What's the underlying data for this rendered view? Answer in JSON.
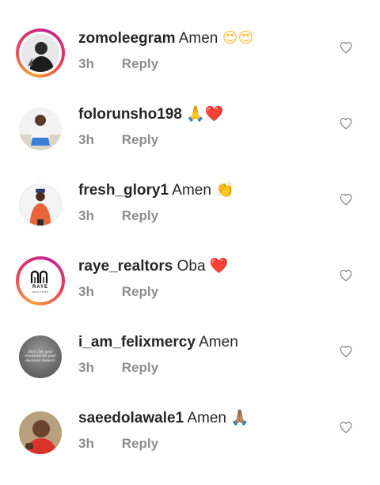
{
  "comments": [
    {
      "username": "zomoleegram",
      "text": "Amen",
      "emoji": "😍😍",
      "time": "3h",
      "reply": "Reply",
      "story_ring": true,
      "emoji_color": "#f6c343"
    },
    {
      "username": "folorunsho198",
      "text": "",
      "emoji": "🙏❤️",
      "time": "3h",
      "reply": "Reply",
      "story_ring": false,
      "emoji_color": "#e0302f"
    },
    {
      "username": "fresh_glory1",
      "text": "Amen",
      "emoji": "👏",
      "time": "3h",
      "reply": "Reply",
      "story_ring": false,
      "emoji_color": "#f6c343"
    },
    {
      "username": "raye_realtors",
      "text": "Oba",
      "emoji": "❤️",
      "time": "3h",
      "reply": "Reply",
      "story_ring": true,
      "emoji_color": "#e0302f"
    },
    {
      "username": "i_am_felixmercy",
      "text": "Amen",
      "emoji": "",
      "time": "3h",
      "reply": "Reply",
      "story_ring": false,
      "emoji_color": "#262626"
    },
    {
      "username": "saeedolawale1",
      "text": "Amen",
      "emoji": "🙏🏽",
      "time": "3h",
      "reply": "Reply",
      "story_ring": false,
      "emoji_color": "#c99a72"
    }
  ],
  "avatars": {
    "raye_logo_word": "RAYE",
    "raye_logo_sub": "REALTORS",
    "felix_avatar_text": "Don't let your emotions be your decision makers"
  },
  "colors": {
    "username": "#262626",
    "meta": "#8e8e8e",
    "heart_outline": "#8e8e8e",
    "story_ring_start": "#f9a23a",
    "story_ring_end": "#c1278f"
  },
  "icons": {
    "like": "heart-outline-icon"
  }
}
